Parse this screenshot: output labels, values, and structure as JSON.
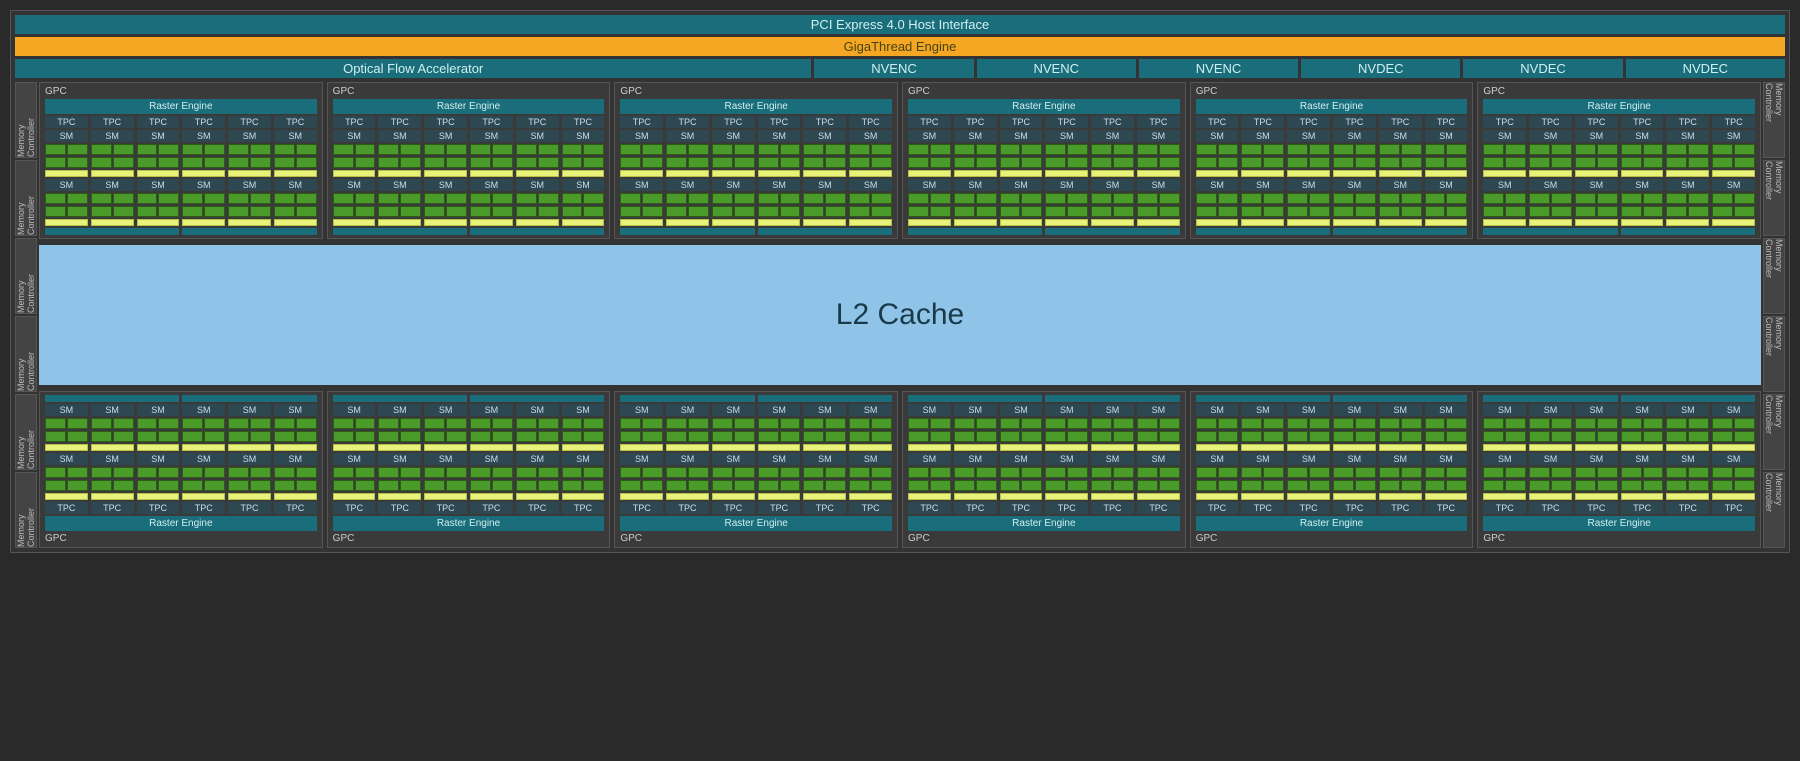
{
  "top": {
    "pci": "PCI Express 4.0 Host Interface",
    "gigathread": "GigaThread Engine",
    "ofa": "Optical Flow Accelerator",
    "encoders": [
      "NVENC",
      "NVENC",
      "NVENC",
      "NVDEC",
      "NVDEC",
      "NVDEC"
    ]
  },
  "labels": {
    "memctrl": "Memory Controller",
    "gpc": "GPC",
    "raster": "Raster Engine",
    "tpc": "TPC",
    "sm": "SM",
    "l2": "L2 Cache"
  },
  "layout": {
    "gpc_per_row": 6,
    "tpc_per_gpc": 6,
    "sm_rows_per_gpc": 2,
    "memctrl_per_side": 6
  }
}
